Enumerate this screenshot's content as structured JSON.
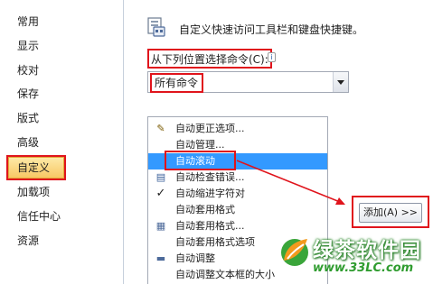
{
  "sidebar": {
    "items": [
      {
        "label": "常用"
      },
      {
        "label": "显示"
      },
      {
        "label": "校对"
      },
      {
        "label": "保存"
      },
      {
        "label": "版式"
      },
      {
        "label": "高级"
      },
      {
        "label": "自定义",
        "active": true
      },
      {
        "label": "加载项"
      },
      {
        "label": "信任中心"
      },
      {
        "label": "资源"
      }
    ]
  },
  "header": {
    "title": "自定义快速访问工具栏和键盘快捷键。",
    "icon": "customize-toolbar-icon"
  },
  "choose_commands": {
    "label": "从下列位置选择命令(C):",
    "info_icon_glyph": "i",
    "selected_value": "所有命令"
  },
  "command_list": {
    "items": [
      {
        "label": "自动更正选项...",
        "icon": "autocorrect-icon",
        "glyph": "✎"
      },
      {
        "label": "自动管理...",
        "icon": "",
        "glyph": ""
      },
      {
        "label": "自动滚动",
        "icon": "",
        "glyph": "",
        "selected": true
      },
      {
        "label": "自动检查错误...",
        "icon": "check-errors-icon",
        "glyph": "▤"
      },
      {
        "label": "自动缩进字符对",
        "icon": "checkmark-icon",
        "glyph": "✓"
      },
      {
        "label": "自动套用格式",
        "icon": "",
        "glyph": ""
      },
      {
        "label": "自动套用格式...",
        "icon": "autoformat-icon",
        "glyph": "▦"
      },
      {
        "label": "自动套用格式选项",
        "icon": "",
        "glyph": ""
      },
      {
        "label": "自动调整",
        "icon": "adjust-icon",
        "glyph": "▬"
      },
      {
        "label": "自动调整文本框的大小",
        "icon": "",
        "glyph": ""
      }
    ]
  },
  "add_button": {
    "label": "添加(A) >>"
  },
  "watermark": {
    "name": "绿茶软件园",
    "url": "www.33LC.com"
  },
  "colors": {
    "annotation_red": "#e0141c",
    "active_nav": "#f8c865",
    "selection_blue": "#3399ff",
    "watermark_green": "#2e8b2e"
  }
}
